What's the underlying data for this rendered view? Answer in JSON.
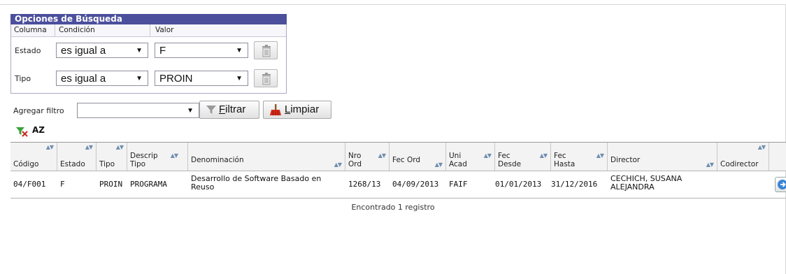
{
  "panel": {
    "title": "Opciones de Búsqueda",
    "col_columna": "Columna",
    "col_condicion": "Condición",
    "col_valor": "Valor"
  },
  "filters": [
    {
      "label": "Estado",
      "condition": "es igual a",
      "value": "F"
    },
    {
      "label": "Tipo",
      "condition": "es igual a",
      "value": "PROIN"
    }
  ],
  "toolbar": {
    "agregar_label": "Agregar filtro",
    "agregar_value": "",
    "filtrar_rest": "iltrar",
    "filtrar_key": "F",
    "limpiar_rest": "impiar",
    "limpiar_key": "L",
    "sort_icon_text": "AZ"
  },
  "grid": {
    "headers": {
      "codigo": "Código",
      "estado": "Estado",
      "tipo": "Tipo",
      "descrip1": "Descrip",
      "descrip2": "Tipo",
      "denominacion": "Denominación",
      "nro1": "Nro",
      "nro2": "Ord",
      "fecord": "Fec Ord",
      "uni1": "Uni",
      "uni2": "Acad",
      "fdesde1": "Fec",
      "fdesde2": "Desde",
      "fhasta1": "Fec",
      "fhasta2": "Hasta",
      "director": "Director",
      "codirector": "Codirector"
    },
    "rows": [
      {
        "codigo": "04/F001",
        "estado": "F",
        "tipo": "PROIN",
        "descrip": "PROGRAMA",
        "denominacion": "Desarrollo de Software Basado en Reuso",
        "nro": "1268/13",
        "fecord": "04/09/2013",
        "uni": "FAIF",
        "fdesde": "01/01/2013",
        "fhasta": "31/12/2016",
        "director": "CECHICH, SUSANA ALEJANDRA",
        "codirector": ""
      }
    ],
    "footer": "Encontrado 1 registro"
  },
  "colors": {
    "title_bg": "#4b4f9c",
    "sort_arrows": "#6f8fb0",
    "limpiar_icon": "#d42a1a",
    "go_icon": "#3b83d6"
  },
  "icons": {
    "sort_glyph": "▲▼",
    "dropdown_glyph": "▼"
  }
}
